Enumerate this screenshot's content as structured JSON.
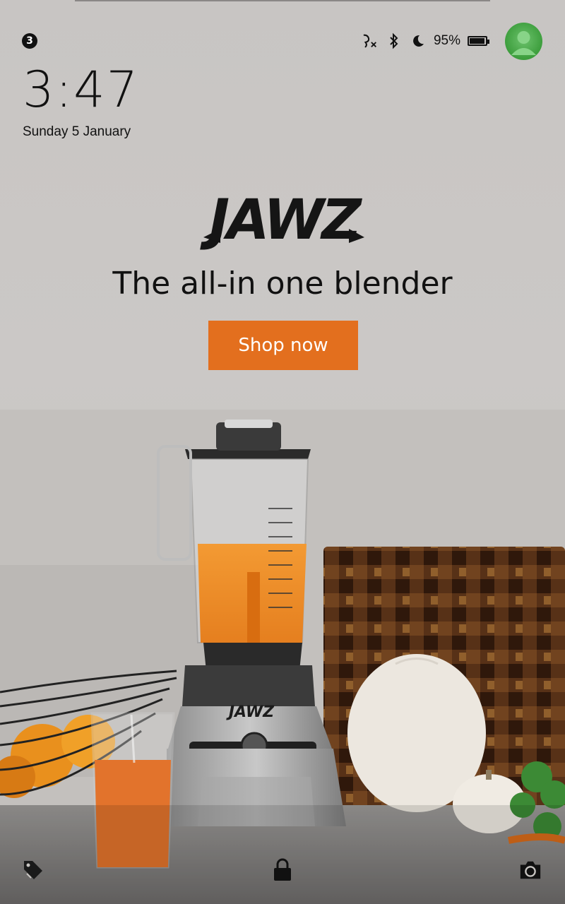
{
  "status_bar": {
    "notification_count": "3",
    "battery_percent": "95%",
    "battery_level": 0.95,
    "icons": [
      "call-muted-icon",
      "bluetooth-icon",
      "do-not-disturb-moon-icon",
      "battery-icon"
    ]
  },
  "lock_screen": {
    "time": "3:47",
    "date": "Sunday 5 January"
  },
  "ad": {
    "brand": "JAWZ",
    "tagline": "The all-in one blender",
    "cta_label": "Shop now",
    "cta_color": "#e36f1e"
  },
  "bottom_bar": {
    "icons": [
      "offers-tag-icon",
      "lock-icon",
      "camera-icon"
    ]
  }
}
